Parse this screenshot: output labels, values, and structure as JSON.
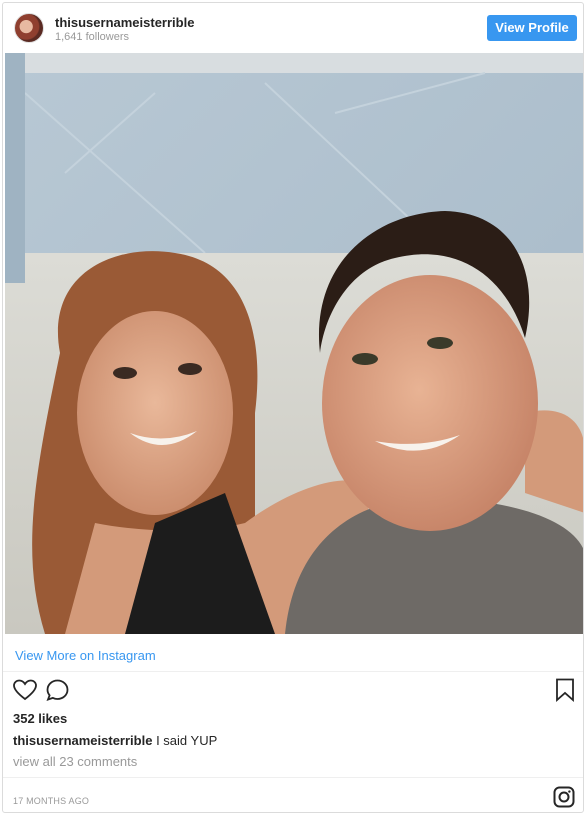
{
  "header": {
    "username": "thisusernameisterrible",
    "followers": "1,641 followers",
    "view_profile_label": "View Profile"
  },
  "post": {
    "view_more_label": "View More on Instagram",
    "likes": "352 likes",
    "caption_user": "thisusernameisterrible",
    "caption_text": "I said YUP",
    "comments_link": "view all 23 comments",
    "timestamp": "17 MONTHS AGO"
  },
  "icons": [
    "heart-icon",
    "comment-icon",
    "bookmark-icon",
    "instagram-logo-icon"
  ],
  "colors": {
    "accent": "#3897f0",
    "muted": "#999999",
    "text": "#262626"
  }
}
